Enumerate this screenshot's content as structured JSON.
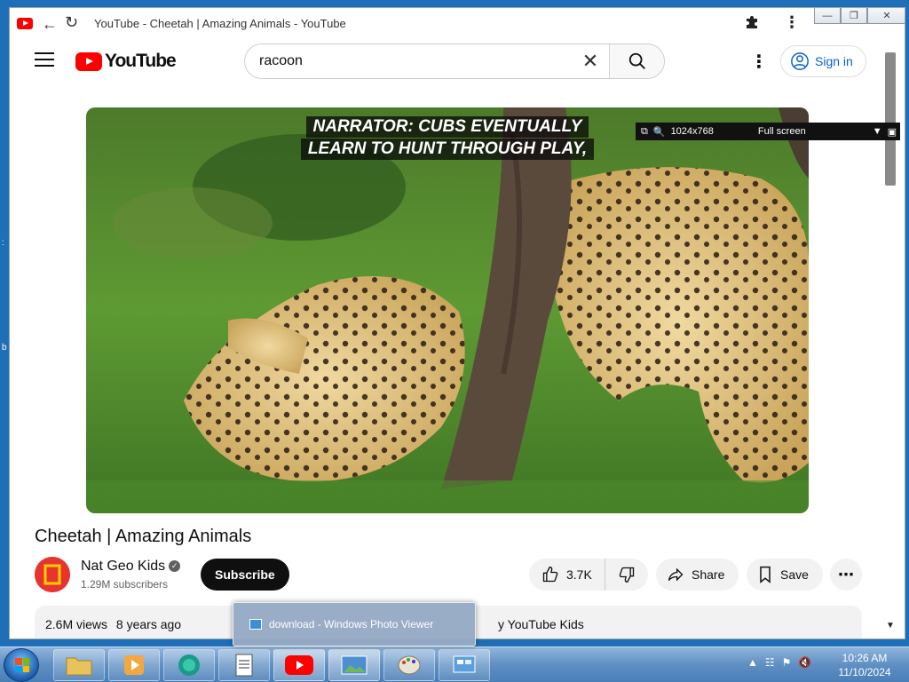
{
  "browser": {
    "tab_title": "YouTube - Cheetah | Amazing Animals - YouTube"
  },
  "header": {
    "logo_text": "YouTube",
    "search": {
      "value": "racoon"
    },
    "sign_in_label": "Sign in"
  },
  "video": {
    "caption_line1": "NARRATOR: CUBS EVENTUALLY",
    "caption_line2": "LEARN TO HUNT THROUGH PLAY,"
  },
  "info_tooltip": {
    "resolution": "1024x768",
    "mode": "Full screen"
  },
  "meta": {
    "title": "Cheetah | Amazing Animals",
    "channel_name": "Nat Geo Kids",
    "subscribers": "1.29M subscribers",
    "subscribe_label": "Subscribe",
    "likes": "3.7K",
    "share_label": "Share",
    "save_label": "Save",
    "views": "2.6M views",
    "age": "8 years ago",
    "desc_fragment": "y YouTube Kids"
  },
  "taskbar_preview": {
    "label": "download - Windows Photo Viewer"
  },
  "clock": {
    "time": "10:26 AM",
    "date": "11/10/2024"
  },
  "colors": {
    "youtube_red": "#ff0000",
    "link_blue": "#065fd4",
    "taskbar_blue": "#5f8fc3"
  }
}
